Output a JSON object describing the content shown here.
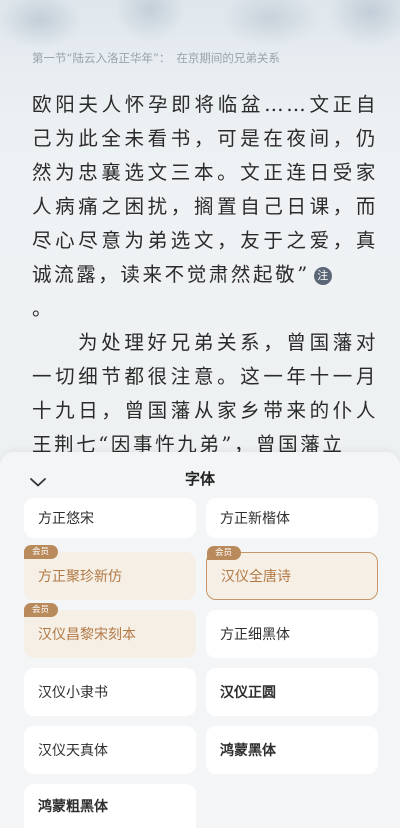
{
  "reader": {
    "chapter_title": "第一节“陆云入洛正华年”：",
    "section_title": "在京期间的兄弟关系",
    "paragraph1": "欧阳夫人怀孕即将临盆……文正自己为此全未看书，可是在夜间，仍然为忠襄选文三本。文正连日受家人病痛之困扰，搁置自己日课，而尽心尽意为弟选文，友于之爱，真诚流露，读来不觉肃然起敬”",
    "note_label": "注",
    "paragraph1_end": "。",
    "paragraph2": "为处理好兄弟关系，曾国藩对一切细节都很注意。这一年十一月十九日，曾国藩从家乡带来的仆人王荆七“因事忤九弟”，曾国藩立"
  },
  "font_panel": {
    "title": "字体",
    "vip_badge": "会员",
    "fonts": [
      {
        "name": "方正悠宋",
        "vip": false,
        "selected": false
      },
      {
        "name": "方正新楷体",
        "vip": false,
        "selected": false
      },
      {
        "name": "方正聚珍新仿",
        "vip": true,
        "selected": false
      },
      {
        "name": "汉仪全唐诗",
        "vip": true,
        "selected": true
      },
      {
        "name": "汉仪昌黎宋刻本",
        "vip": true,
        "selected": false
      },
      {
        "name": "方正细黑体",
        "vip": false,
        "selected": false
      },
      {
        "name": "汉仪小隶书",
        "vip": false,
        "selected": false
      },
      {
        "name": "汉仪正圆",
        "vip": false,
        "selected": false
      },
      {
        "name": "汉仪天真体",
        "vip": false,
        "selected": false
      },
      {
        "name": "鸿蒙黑体",
        "vip": false,
        "selected": false
      },
      {
        "name": "鸿蒙粗黑体",
        "vip": false,
        "selected": false
      }
    ]
  },
  "colors": {
    "accent": "#b98a5b",
    "vip_card_bg": "#f6efe6",
    "selected_border": "#c59766"
  },
  "icons": {
    "collapse": "chevron-down-icon",
    "note": "note-icon"
  }
}
